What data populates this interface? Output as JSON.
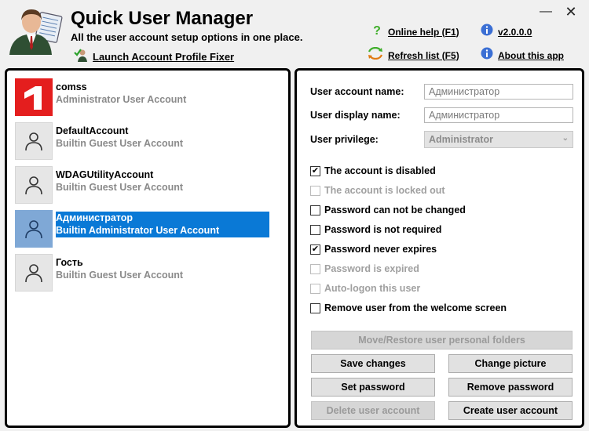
{
  "app": {
    "title": "Quick User Manager",
    "subtitle": "All the user account setup options in one place.",
    "fixer_link": "Launch Account Profile Fixer"
  },
  "header_links": {
    "help": "Online help (F1)",
    "refresh": "Refresh list (F5)",
    "version": "v2.0.0.0",
    "about": "About this app"
  },
  "icons": {
    "minimize": "minimize-icon",
    "close": "close-icon",
    "help": "question-icon",
    "refresh": "refresh-icon",
    "info": "info-icon",
    "user": "user-icon"
  },
  "colors": {
    "selection": "#0a79d6",
    "avatar_selected": "#7fa8d6",
    "brand": "#e41e1e"
  },
  "users": [
    {
      "name": "comss",
      "desc": "Administrator User Account",
      "avatar": "brand",
      "selected": false
    },
    {
      "name": "DefaultAccount",
      "desc": "Builtin Guest User Account",
      "avatar": "user",
      "selected": false
    },
    {
      "name": "WDAGUtilityAccount",
      "desc": "Builtin Guest User Account",
      "avatar": "user",
      "selected": false
    },
    {
      "name": "Администратор",
      "desc": "Builtin Administrator User Account",
      "avatar": "user",
      "selected": true
    },
    {
      "name": "Гость",
      "desc": "Builtin Guest User Account",
      "avatar": "user",
      "selected": false
    }
  ],
  "form": {
    "account_name_label": "User account name:",
    "account_name_value": "Администратор",
    "display_name_label": "User display name:",
    "display_name_value": "Администратор",
    "privilege_label": "User privilege:",
    "privilege_value": "Administrator"
  },
  "options": [
    {
      "label": "The account is disabled",
      "checked": true,
      "enabled": true
    },
    {
      "label": "The account is locked out",
      "checked": false,
      "enabled": false
    },
    {
      "label": "Password can not be changed",
      "checked": false,
      "enabled": true
    },
    {
      "label": "Password is not required",
      "checked": false,
      "enabled": true
    },
    {
      "label": "Password never expires",
      "checked": true,
      "enabled": true
    },
    {
      "label": "Password is expired",
      "checked": false,
      "enabled": false
    },
    {
      "label": "Auto-logon this user",
      "checked": false,
      "enabled": false
    },
    {
      "label": "Remove user from the welcome screen",
      "checked": false,
      "enabled": true
    }
  ],
  "buttons": {
    "move_restore": "Move/Restore user personal folders",
    "save": "Save changes",
    "change_picture": "Change picture",
    "set_password": "Set password",
    "remove_password": "Remove password",
    "delete_user": "Delete user account",
    "create_user": "Create user account"
  }
}
